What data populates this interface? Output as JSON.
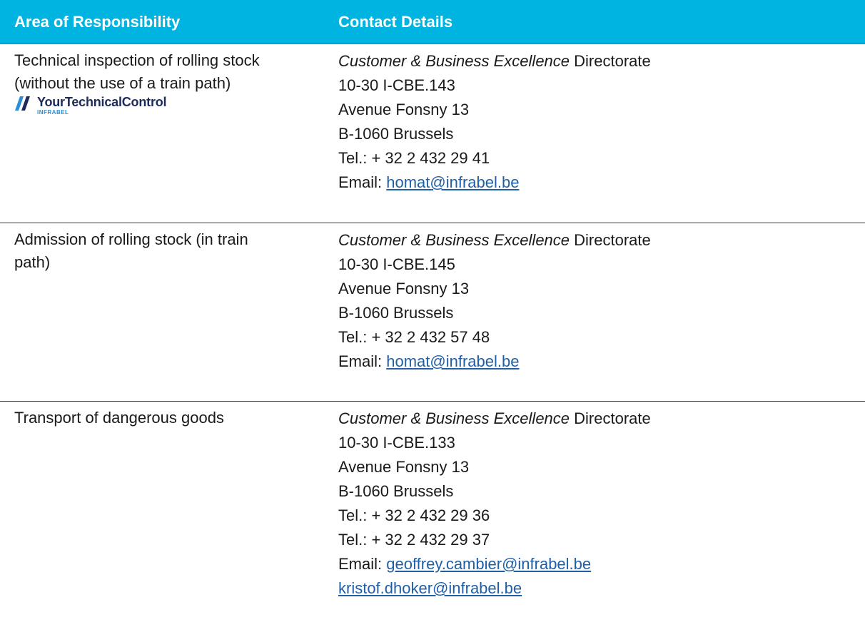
{
  "header": {
    "area": "Area of Responsibility",
    "contact": "Contact Details"
  },
  "rows": [
    {
      "area_lines": [
        "Technical inspection of rolling stock",
        "(without the use of a train path)"
      ],
      "logo": {
        "name": "YourTechnicalControl",
        "sub": "INFRABEL",
        "icon": "double-slash-icon",
        "colors": {
          "text": "#1d2a5c",
          "accent": "#2a8fd8"
        }
      },
      "directorate_italic": "Customer & Business Excellence",
      "directorate_suffix": " Directorate",
      "code": "10-30 I-CBE.143",
      "street": "Avenue Fonsny 13",
      "city": "B-1060 Brussels",
      "phones": [
        "Tel.: + 32 2 432 29 41"
      ],
      "email_prefix": "Email: ",
      "emails": [
        "homat@infrabel.be"
      ]
    },
    {
      "area_lines": [
        "Admission of rolling stock (in train",
        "path)"
      ],
      "directorate_italic": "Customer & Business Excellence",
      "directorate_suffix": " Directorate",
      "code": "10-30 I-CBE.145",
      "street": "Avenue Fonsny 13",
      "city": "B-1060 Brussels",
      "phones": [
        "Tel.: + 32 2 432 57 48"
      ],
      "email_prefix": "Email: ",
      "emails": [
        "homat@infrabel.be"
      ]
    },
    {
      "area_lines": [
        "Transport of dangerous goods"
      ],
      "directorate_italic": "Customer & Business Excellence",
      "directorate_suffix": " Directorate",
      "code": "10-30 I-CBE.133",
      "street": "Avenue Fonsny 13",
      "city": "B-1060 Brussels",
      "phones": [
        "Tel.: + 32 2 432 29 36",
        "Tel.: + 32 2 432 29 37"
      ],
      "email_prefix": "Email: ",
      "emails": [
        "geoffrey.cambier@infrabel.be",
        "kristof.dhoker@infrabel.be"
      ]
    }
  ],
  "colors": {
    "header_bg": "#00b4e1",
    "header_text": "#ffffff",
    "link": "#1f5fa8"
  }
}
